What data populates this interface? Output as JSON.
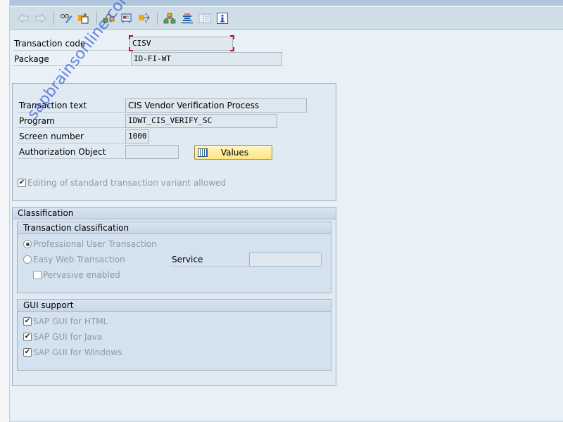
{
  "toolbar": {
    "items": [
      {
        "icon": "back-arrow-icon",
        "tooltip": "Back"
      },
      {
        "icon": "forward-arrow-icon",
        "tooltip": "Forward"
      },
      {
        "icon": "display-change-icon",
        "tooltip": "Display/Change"
      },
      {
        "icon": "other-object-icon",
        "tooltip": "Other object"
      },
      {
        "icon": "check-icon",
        "tooltip": "Check"
      },
      {
        "icon": "activate-icon",
        "tooltip": "Activate"
      },
      {
        "icon": "test-icon",
        "tooltip": "Test"
      },
      {
        "icon": "hierarchy-icon",
        "tooltip": "Object list"
      },
      {
        "icon": "where-used-icon",
        "tooltip": "Where-used list"
      },
      {
        "icon": "documentation-icon",
        "tooltip": "Documentation"
      },
      {
        "icon": "info-icon",
        "tooltip": "Information"
      }
    ]
  },
  "header": {
    "transaction_code_label": "Transaction code",
    "transaction_code_value": "CISV",
    "package_label": "Package",
    "package_value": "ID-FI-WT"
  },
  "details": {
    "transaction_text_label": "Transaction text",
    "transaction_text_value": "CIS Vendor Verification Process",
    "program_label": "Program",
    "program_value": "IDWT_CIS_VERIFY_SC",
    "screen_number_label": "Screen number",
    "screen_number_value": "1000",
    "authorization_object_label": "Authorization Object",
    "authorization_object_value": "",
    "values_button_label": "Values",
    "editing_variant_label": "Editing of standard transaction variant allowed",
    "editing_variant_checked": true
  },
  "classification": {
    "title": "Classification",
    "transaction_classification": {
      "title": "Transaction classification",
      "professional_label": "Professional User Transaction",
      "professional_selected": true,
      "easy_web_label": "Easy Web Transaction",
      "easy_web_selected": false,
      "service_label": "Service",
      "service_value": "",
      "pervasive_label": "Pervasive enabled",
      "pervasive_checked": false
    },
    "gui_support": {
      "title": "GUI support",
      "html_label": "SAP GUI for HTML",
      "html_checked": true,
      "java_label": "SAP GUI for Java",
      "java_checked": true,
      "windows_label": "SAP GUI for Windows",
      "windows_checked": true
    }
  },
  "watermark": "sapbrainsonline.com",
  "colors": {
    "toolbar_bg": "#cfdde6",
    "content_bg": "#e9f0f7",
    "values_button": "#fde680",
    "required_marker": "#c8102e"
  }
}
